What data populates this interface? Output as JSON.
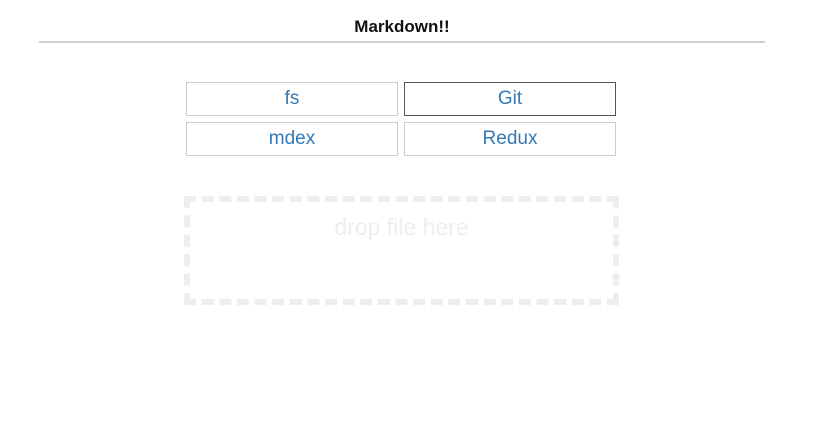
{
  "header": {
    "title": "Markdown!!"
  },
  "tiles": [
    {
      "label": "fs"
    },
    {
      "label": "Git"
    },
    {
      "label": "mdex"
    },
    {
      "label": "Redux"
    }
  ],
  "dropzone": {
    "text": "drop file here"
  },
  "colors": {
    "link": "#337ab7",
    "tile_border": "#cccccc",
    "focused_border": "#555555",
    "dropzone_border": "#eeeeee",
    "dropzone_text": "#eeeeee",
    "header_rule": "#cfcfcf"
  }
}
